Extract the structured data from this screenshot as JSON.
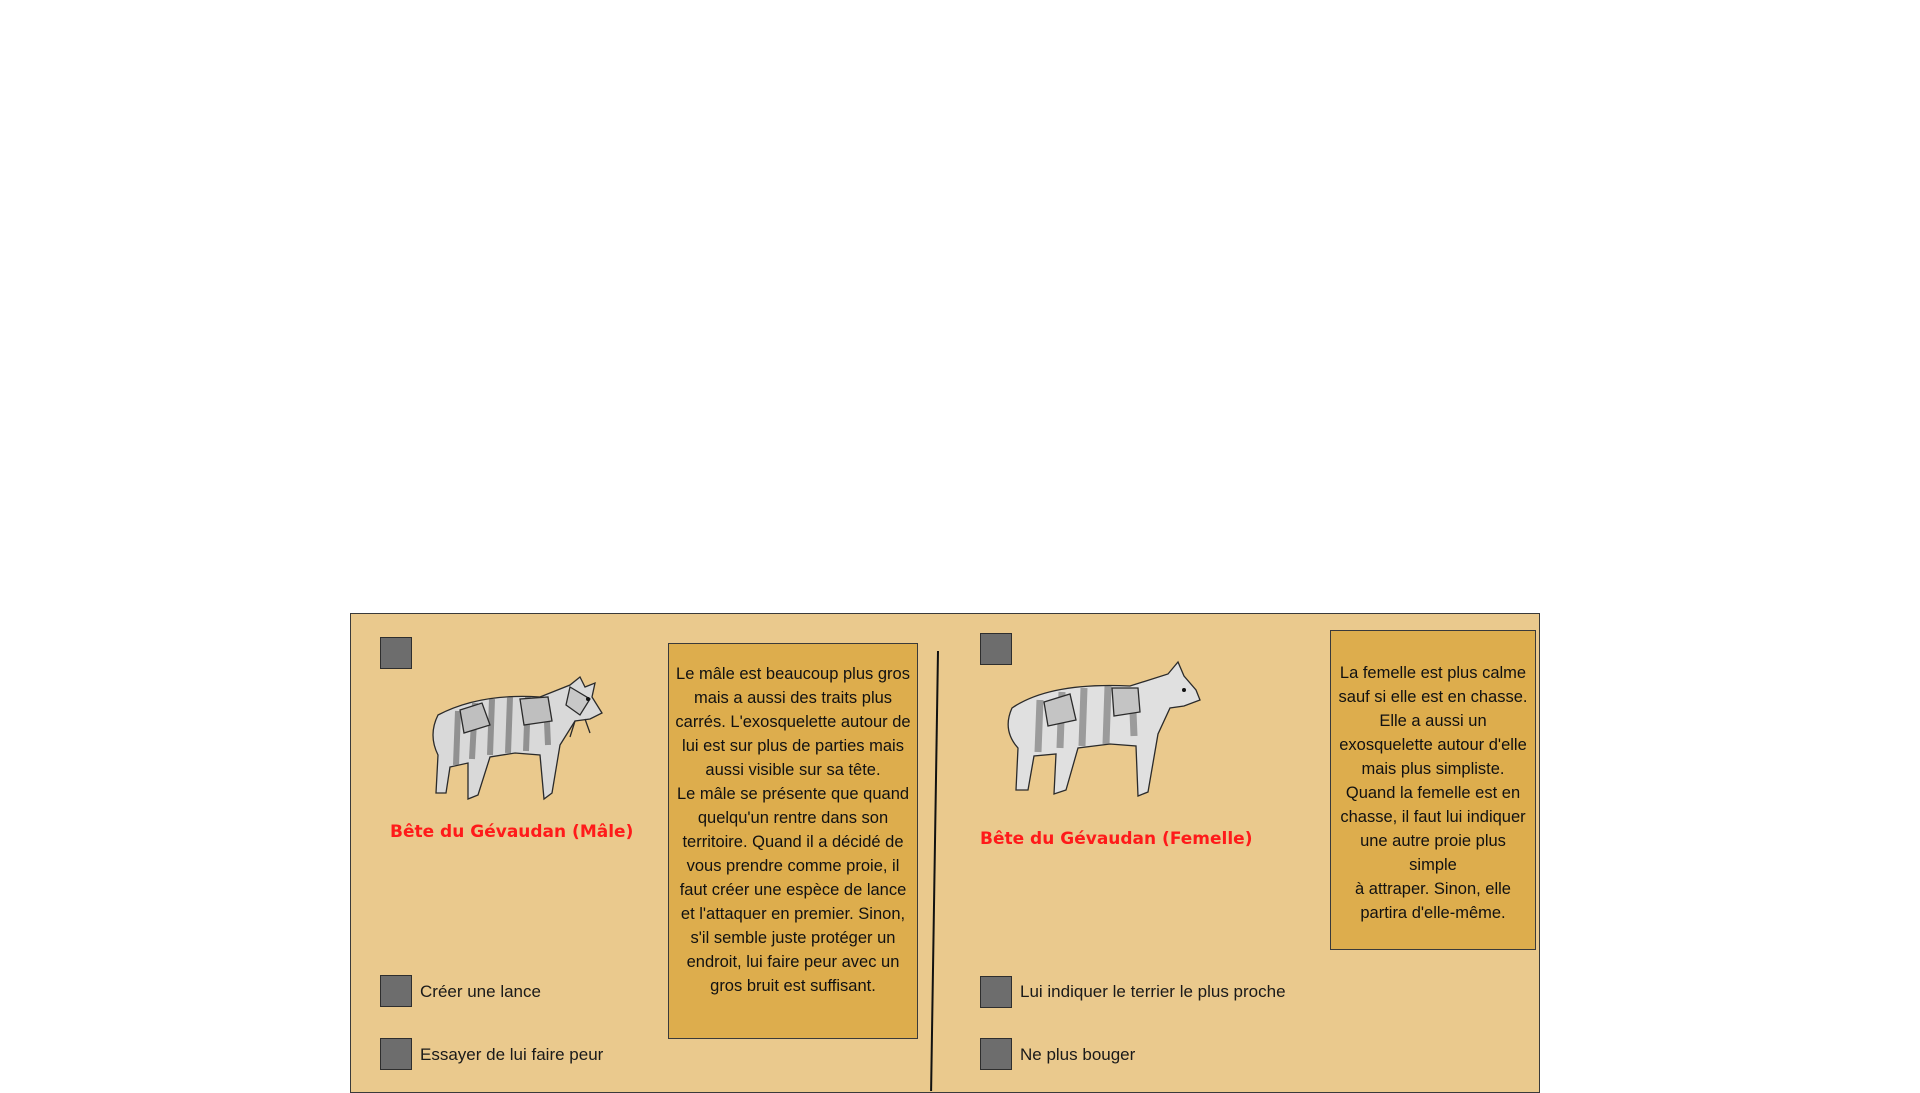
{
  "male": {
    "title": "Bête du Gévaudan (Mâle)",
    "image_icon": "wolf-beast-male-illustration",
    "description": "Le mâle est beaucoup plus gros\nmais a aussi des traits plus\ncarrés. L'exosquelette autour de\nlui est sur plus de parties mais\naussi visible sur sa tête.\nLe mâle se présente que quand\nquelqu'un rentre dans son\nterritoire. Quand il a décidé de\nvous prendre comme proie, il\nfaut créer une espèce de lance\net l'attaquer en premier. Sinon,\ns'il semble juste protéger un\nendroit, lui faire peur avec un\ngros bruit est suffisant.",
    "options": [
      {
        "label": "Créer une lance"
      },
      {
        "label": "Essayer de lui faire peur"
      }
    ]
  },
  "female": {
    "title": "Bête du Gévaudan (Femelle)",
    "image_icon": "wolf-beast-female-illustration",
    "description": "La femelle est plus calme\nsauf si elle est en chasse.\nElle a aussi un\nexosquelette autour d'elle\nmais plus simpliste.\nQuand la femelle est en\nchasse, il faut lui indiquer\nune autre proie plus simple\nà attraper. Sinon, elle\npartira d'elle-même.",
    "options": [
      {
        "label": "Lui indiquer le terrier le plus proche"
      },
      {
        "label": "Ne plus bouger"
      }
    ]
  },
  "colors": {
    "card_background": "#eac98d",
    "description_background": "#ddad4d",
    "title_color": "#ff1a1a",
    "checkbox_fill": "#6d6d6d"
  }
}
